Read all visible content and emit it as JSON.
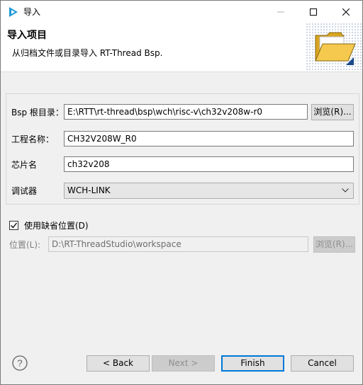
{
  "window": {
    "title": "导入"
  },
  "header": {
    "title": "导入项目",
    "description": "从归档文件或目录导入 RT-Thread Bsp."
  },
  "form": {
    "bsp_label": "Bsp 根目录：",
    "bsp_value": "E:\\RTT\\rt-thread\\bsp\\wch\\risc-v\\ch32v208w-r0",
    "bsp_browse": "浏览(R)...",
    "project_label": "工程名称：",
    "project_value": "CH32V208W_R0",
    "chip_label": "芯片名",
    "chip_value": "ch32v208",
    "debugger_label": "调试器",
    "debugger_value": "WCH-LINK"
  },
  "location": {
    "use_default_label": "使用缺省位置(D)",
    "use_default_checked": true,
    "location_label": "位置(L):",
    "location_value": "D:\\RT-ThreadStudio\\workspace",
    "browse": "浏览(R)..."
  },
  "footer": {
    "back": "< Back",
    "next": "Next >",
    "finish": "Finish",
    "cancel": "Cancel"
  },
  "colors": {
    "accent": "#0078d7",
    "folder": "#f5c94e"
  }
}
